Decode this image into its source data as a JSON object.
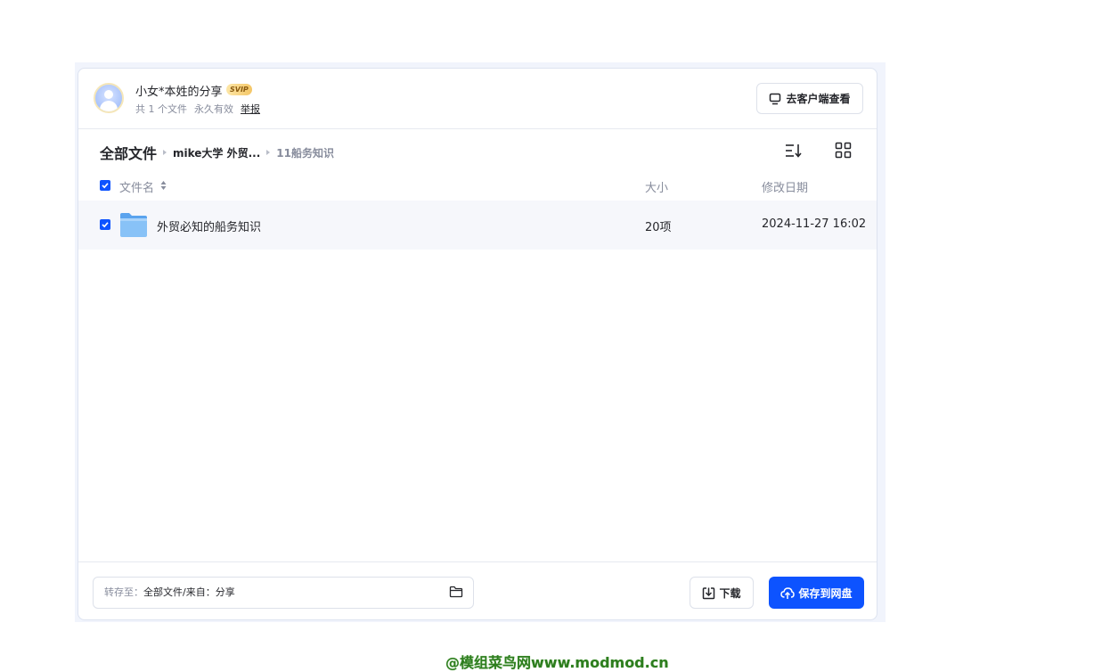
{
  "share": {
    "owner_name": "小女*本姓的分享",
    "badge": "SVIP",
    "file_count": "共 1 个文件",
    "validity": "永久有效",
    "report": "举报",
    "client_button": "去客户端查看"
  },
  "breadcrumb": {
    "root": "全部文件",
    "middle": "mike大学 外贸...",
    "current": "11船务知识"
  },
  "table": {
    "headers": {
      "name": "文件名",
      "size": "大小",
      "date": "修改日期"
    },
    "rows": [
      {
        "name": "外贸必知的船务知识",
        "size": "20项",
        "date": "2024-11-27 16:02",
        "icon": "folder-icon",
        "checked": true
      }
    ]
  },
  "footer": {
    "save_to_label": "转存至：",
    "save_to_value": "全部文件/来自：分享",
    "download_button": "下载",
    "save_button": "保存到网盘"
  },
  "watermark": "@模组菜鸟网www.modmod.cn",
  "colors": {
    "primary": "#0d53ff",
    "text": "#25262b",
    "muted": "#878c9c",
    "row_bg": "#f6f7fb"
  }
}
